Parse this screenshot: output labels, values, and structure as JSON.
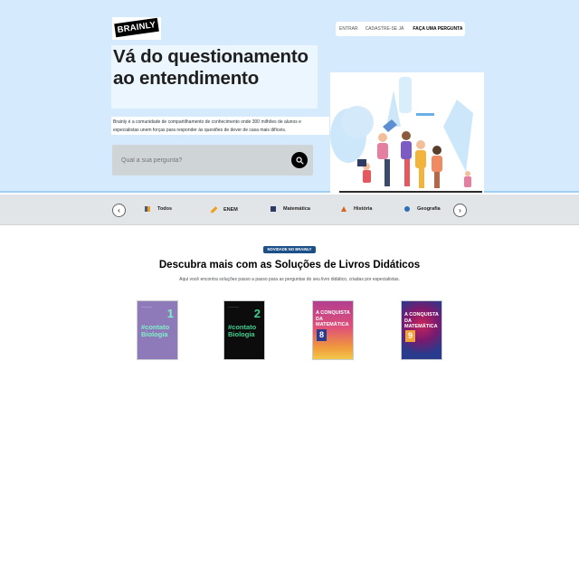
{
  "brand": {
    "logo_text": "BRAINLY"
  },
  "nav": {
    "login": "ENTRAR",
    "signup": "CADASTRE-SE JÁ",
    "ask": "FAÇA UMA PERGUNTA"
  },
  "hero": {
    "headline": "Vá do questionamento ao entendimento",
    "subtitle": "Brainly é a comunidade de compartilhamento de conhecimento onde 300 milhões de alunos e especialistas unem forças para responder às questões de dever de casa mais difíceis.",
    "search_placeholder": "Qual a sua pergunta?"
  },
  "categories": [
    {
      "label": "Todos",
      "icon": "grid-icon",
      "color": "#4a5a78"
    },
    {
      "label": "ENEM",
      "icon": "pencil-icon",
      "color": "#f0a01e"
    },
    {
      "label": "Matemática",
      "icon": "calculator-icon",
      "color": "#2d3c64"
    },
    {
      "label": "História",
      "icon": "pyramid-icon",
      "color": "#d8631c"
    },
    {
      "label": "Geografia",
      "icon": "globe-icon",
      "color": "#2a6fb7"
    }
  ],
  "textbooks": {
    "badge": "NOVIDADE NO BRAINLY",
    "title": "Descubra mais com as Soluções de Livros Didáticos",
    "subtitle": "Aqui você encontra soluções passo a passo para as perguntas do seu livro didático, criadas por especialistas.",
    "books": [
      {
        "cover_text": "#contato Biologia",
        "number": "1",
        "bg": "#8f7ab9"
      },
      {
        "cover_text": "#contato Biologia",
        "number": "2",
        "bg": "#0c0c0c"
      },
      {
        "cover_text": "A CONQUISTA DA MATEMÁTICA",
        "number": "8",
        "bg": "#c85a86"
      },
      {
        "cover_text": "A CONQUISTA DA MATEMÁTICA",
        "number": "9",
        "bg": "#2a3a8c"
      }
    ]
  },
  "colors": {
    "hero_bg": "#d5ebfd",
    "badge_bg": "#1b4f87",
    "category_bar": "#e2e5e7"
  }
}
